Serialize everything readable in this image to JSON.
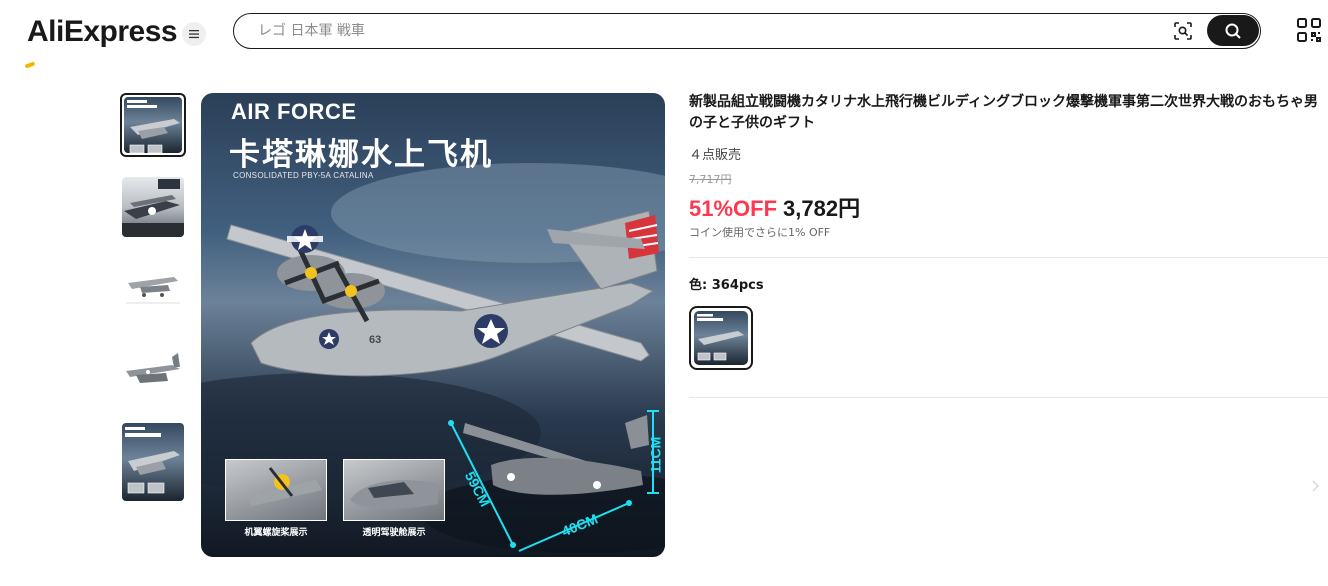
{
  "header": {
    "logo_text": "AliExpress",
    "menu_icon": "hamburger-icon",
    "search_placeholder": "レゴ 日本軍 戦車",
    "camera_icon": "camera-search-icon",
    "search_icon": "search-icon",
    "qr_icon": "qr-code-icon"
  },
  "gallery": {
    "thumbnails": [
      {
        "name": "thumbnail-1",
        "selected": true
      },
      {
        "name": "thumbnail-2",
        "selected": false
      },
      {
        "name": "thumbnail-3",
        "selected": false
      },
      {
        "name": "thumbnail-4",
        "selected": false
      },
      {
        "name": "thumbnail-5",
        "selected": false
      }
    ],
    "main_image": {
      "heading": "AIR FORCE",
      "chinese_title": "卡塔琳娜水上飞机",
      "subtitle": "CONSOLIDATED PBY-5A CATALINA",
      "inset_left_caption": "机翼螺旋桨展示",
      "inset_right_caption": "透明驾驶舱展示",
      "dim_height": "11CM",
      "dim_width": "40CM",
      "dim_length": "59CM",
      "hull_number": "63"
    }
  },
  "product": {
    "title": "新製品組立戦闘機カタリナ水上飛行機ビルディングブロック爆撃機軍事第二次世界大戦のおもちゃ男の子と子供のギフト",
    "sold": "４点販売",
    "original_price": "7,717円",
    "discount": "51%OFF",
    "price": "3,782円",
    "coin_note": "コイン使用でさらに1% OFF",
    "color_label": "色: 364pcs"
  },
  "colors": {
    "accent_red": "#fd384f",
    "text_dark": "#191919",
    "brand_yellow": "#f7b500"
  }
}
